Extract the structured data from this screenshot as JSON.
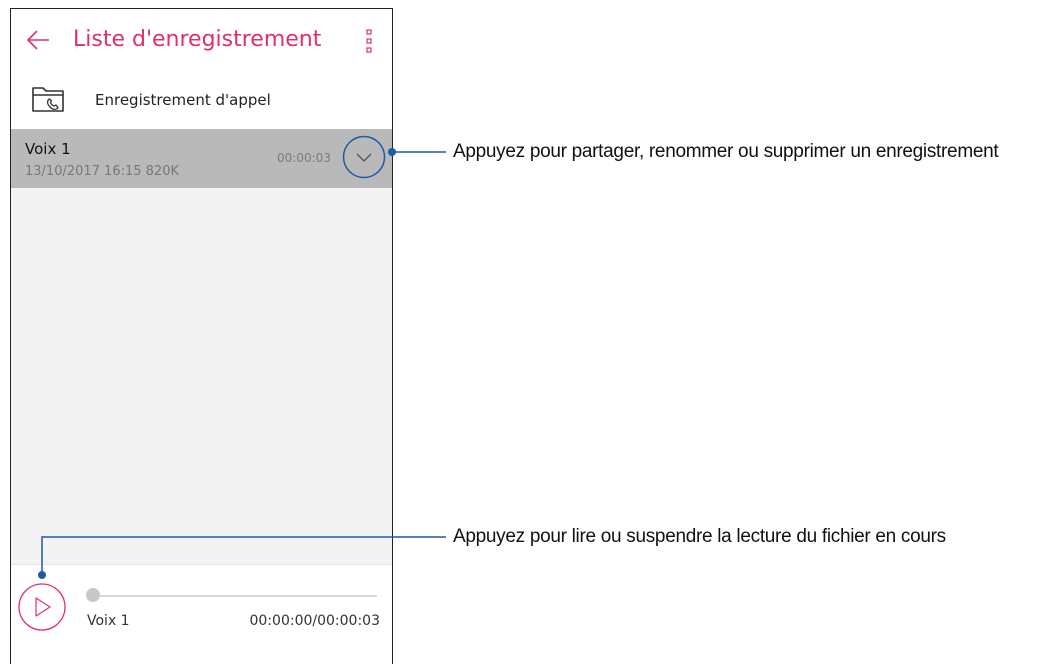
{
  "header": {
    "title": "Liste d'enregistrement"
  },
  "folder": {
    "label": "Enregistrement d'appel"
  },
  "recordings": [
    {
      "name": "Voix 1",
      "meta": "13/10/2017 16:15  820K",
      "duration": "00:00:03"
    }
  ],
  "player": {
    "name": "Voix 1",
    "time": "00:00:00/00:00:03",
    "progress": 0
  },
  "callouts": {
    "expand": "Appuyez pour partager, renommer ou supprimer un enregistrement",
    "play": "Appuyez pour lire ou suspendre la lecture du fichier en cours"
  },
  "colors": {
    "accent": "#e0306a",
    "highlight_circle": "#1f5aa8",
    "selected_row": "#b9b9b9"
  },
  "icons": {
    "back": "back-arrow-icon",
    "menu": "overflow-menu-icon",
    "folder": "call-folder-icon",
    "expand": "chevron-down-icon",
    "play": "play-icon"
  }
}
